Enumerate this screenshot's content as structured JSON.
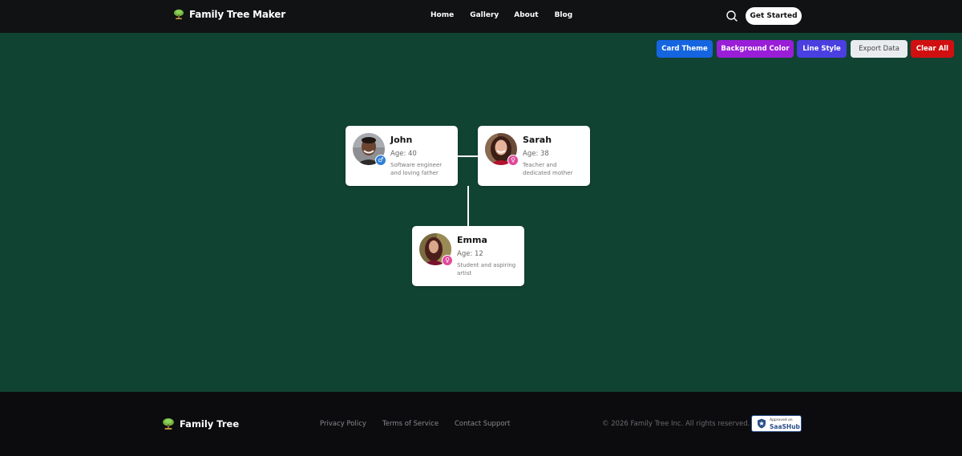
{
  "header": {
    "brand": "Family Tree Maker",
    "nav": [
      "Home",
      "Gallery",
      "About",
      "Blog"
    ],
    "cta": "Get Started"
  },
  "toolbar": {
    "buttons": [
      {
        "label": "Card Theme",
        "color": "#1565e0"
      },
      {
        "label": "Background Color",
        "color": "#9a1ed8"
      },
      {
        "label": "Line Style",
        "color": "#4a3fe0"
      },
      {
        "label": "Export Data",
        "color": "#e9ecef"
      },
      {
        "label": "Clear All",
        "color": "#d01010"
      }
    ]
  },
  "canvas": {
    "background": "#114333"
  },
  "members": [
    {
      "name": "John",
      "age": "Age: 40",
      "description": "Software engineer and loving father",
      "gender": "male",
      "gender_symbol": "♂"
    },
    {
      "name": "Sarah",
      "age": "Age: 38",
      "description": "Teacher and dedicated mother",
      "gender": "female",
      "gender_symbol": "♀"
    },
    {
      "name": "Emma",
      "age": "Age: 12",
      "description": "Student and aspiring artist",
      "gender": "female",
      "gender_symbol": "♀"
    }
  ],
  "footer": {
    "brand": "Family Tree",
    "links": [
      "Privacy Policy",
      "Terms of Service",
      "Contact Support"
    ],
    "copyright": "© 2026 Family Tree Inc. All rights reserved.",
    "badge_small": "Approved on",
    "badge_big": "SaaSHub"
  }
}
